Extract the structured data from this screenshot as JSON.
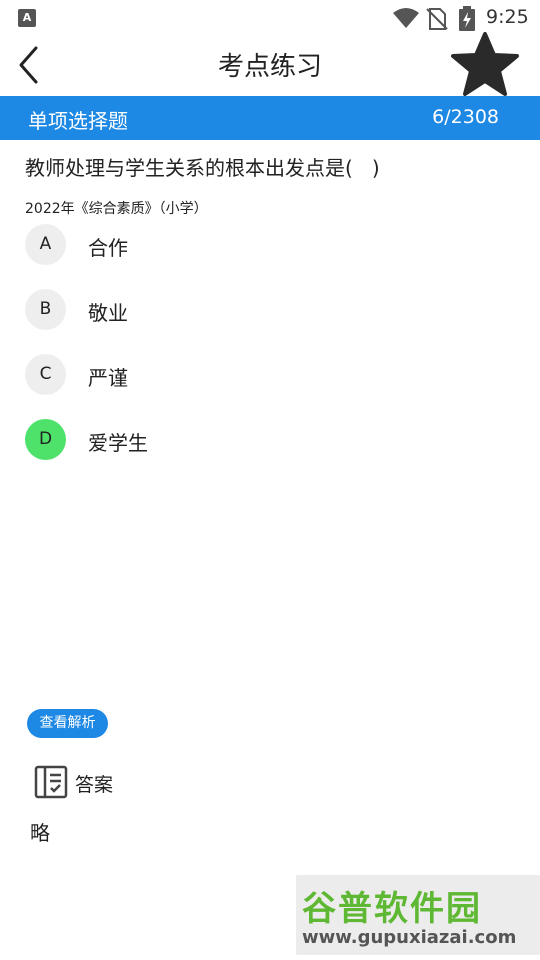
{
  "status_bar": {
    "app_icon_letter": "A",
    "time": "9:25",
    "icons": [
      "wifi-icon",
      "no-sim-icon",
      "battery-charging-icon"
    ]
  },
  "header": {
    "title": "考点练习",
    "back_icon": "chevron-left-icon",
    "favorite_icon": "star-icon"
  },
  "question_type": {
    "label": "单项选择题",
    "progress": "6/2308",
    "bar_color": "#1e88e5"
  },
  "question": {
    "text": "教师处理与学生关系的根本出发点是(   )",
    "source": "2022年《综合素质》（小学）"
  },
  "options": [
    {
      "letter": "A",
      "text": "合作",
      "correct": false
    },
    {
      "letter": "B",
      "text": "敬业",
      "correct": false
    },
    {
      "letter": "C",
      "text": "严谨",
      "correct": false
    },
    {
      "letter": "D",
      "text": "爱学生",
      "correct": true
    }
  ],
  "colors": {
    "correct_option": "#4ee26b",
    "default_option": "#eeeeee"
  },
  "analysis": {
    "button_label": "查看解析",
    "answer_label": "答案",
    "answer_value": "略",
    "answer_icon": "notebook-icon"
  },
  "watermark": {
    "title": "谷普软件园",
    "url": "www.gupuxiazai.com"
  }
}
